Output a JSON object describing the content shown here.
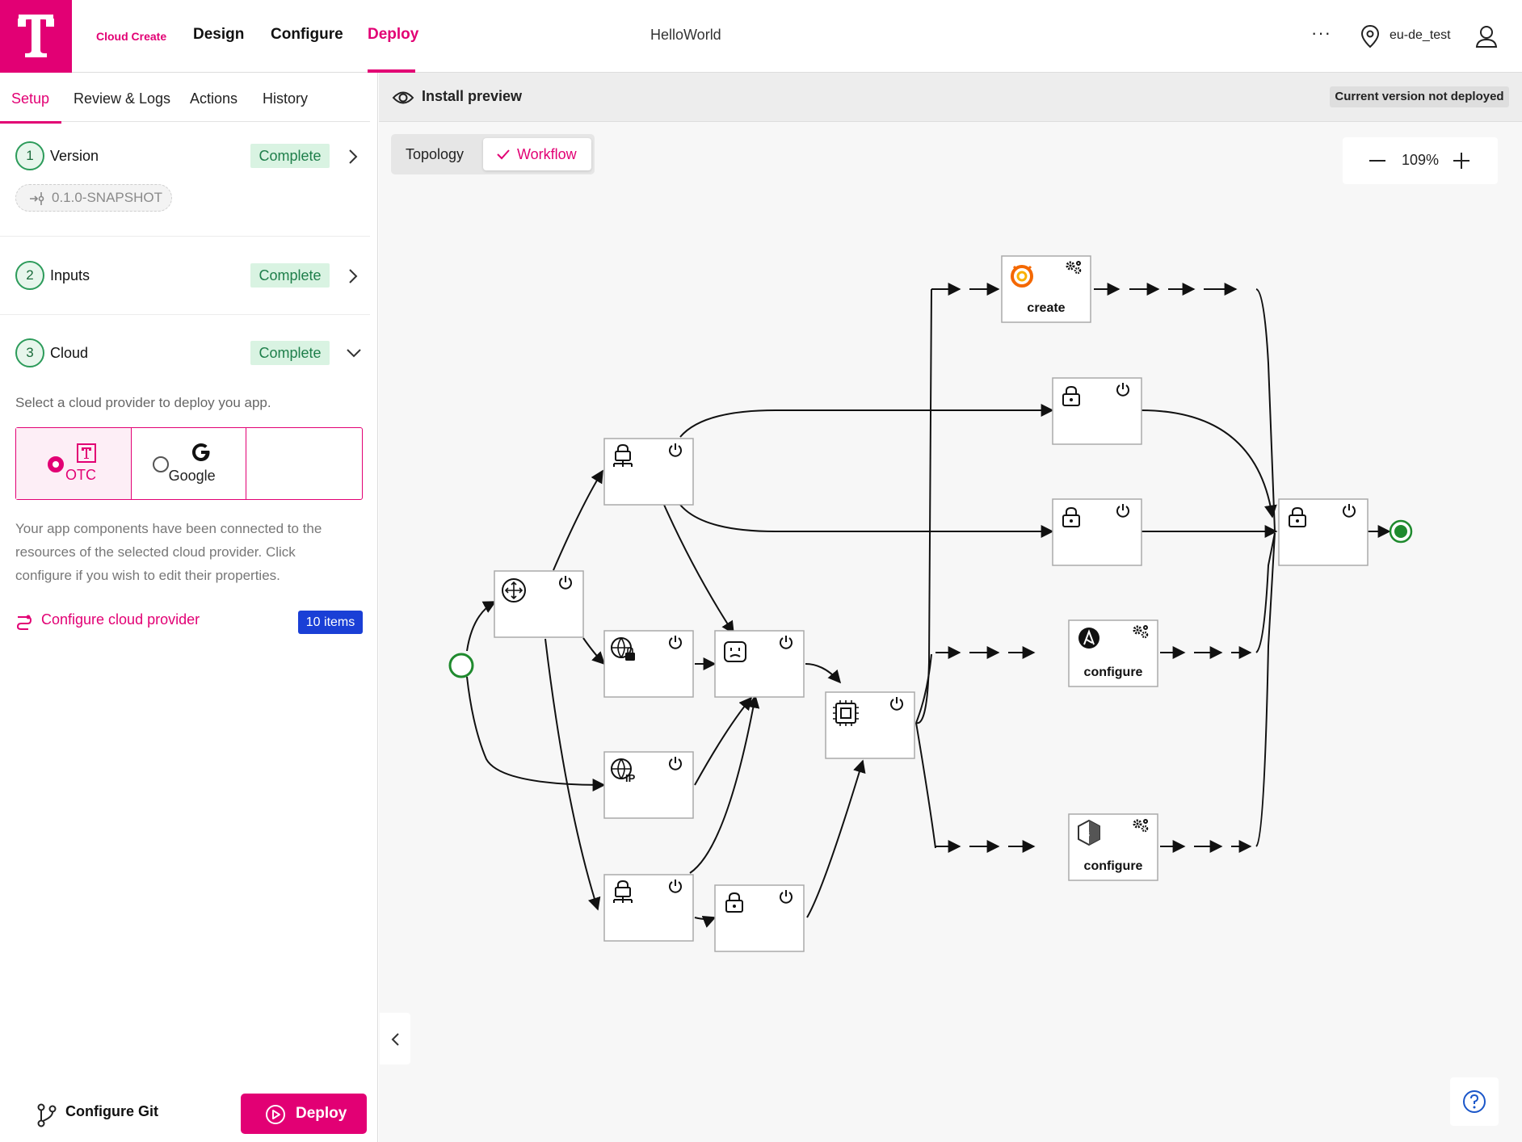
{
  "topbar": {
    "brand": "Cloud Create",
    "nav": [
      "Design",
      "Configure",
      "Deploy"
    ],
    "active_nav": "Deploy",
    "app_name": "HelloWorld",
    "more": "···",
    "region": "eu-de_test"
  },
  "left_panel": {
    "tabs": [
      "Setup",
      "Review & Logs",
      "Actions",
      "History"
    ],
    "active_tab": "Setup",
    "steps": [
      {
        "num": "1",
        "title": "Version",
        "status": "Complete"
      },
      {
        "num": "2",
        "title": "Inputs",
        "status": "Complete"
      },
      {
        "num": "3",
        "title": "Cloud",
        "status": "Complete"
      }
    ],
    "version": "0.1.0-SNAPSHOT",
    "cloud_prompt": "Select a cloud provider to deploy you app.",
    "providers": [
      {
        "label": "OTC",
        "selected": true
      },
      {
        "label": "Google",
        "selected": false
      }
    ],
    "info_text": "Your app components have been connected to the resources of the selected cloud provider. Click configure if you wish to edit their properties.",
    "configure_link": "Configure cloud provider",
    "items_badge": "10 items",
    "configure_git": "Configure Git",
    "deploy_button": "Deploy"
  },
  "preview": {
    "title": "Install preview",
    "status_badge": "Current version not deployed",
    "view_toggle": [
      "Topology",
      "Workflow"
    ],
    "active_view": "Workflow",
    "zoom": "109%"
  },
  "workflow": {
    "node_labels": {
      "grafana": "create",
      "ansible": "configure",
      "script": "configure"
    }
  },
  "colors": {
    "brand": "#e20074",
    "complete_bg": "#d9f3e2",
    "complete_text": "#1f7f4b",
    "badge_blue": "#1a3fd6",
    "start_node": "#1f8a2e"
  }
}
